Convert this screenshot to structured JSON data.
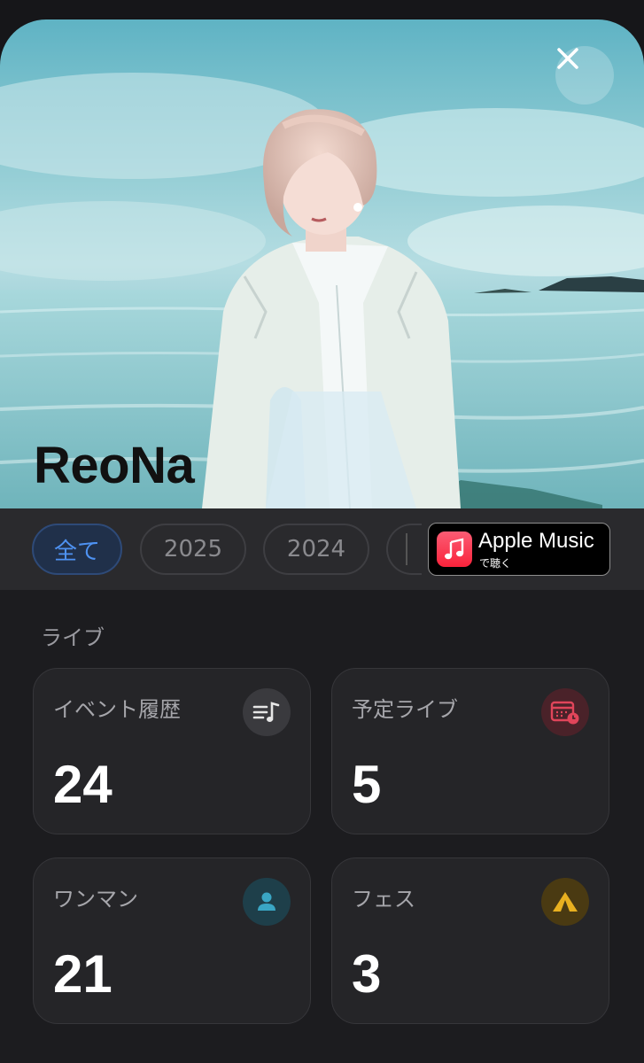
{
  "artist": {
    "name": "ReoNa"
  },
  "filters": {
    "chips": [
      {
        "label": "全て",
        "active": true
      },
      {
        "label": "2025",
        "active": false
      },
      {
        "label": "2024",
        "active": false
      }
    ]
  },
  "apple_music": {
    "title": "Apple Music",
    "subtitle": "で聴く"
  },
  "section": {
    "title": "ライブ"
  },
  "stats": [
    {
      "label": "イベント履歴",
      "value": "24",
      "icon": "playlist-music-icon",
      "icon_color": "#e6e6e6"
    },
    {
      "label": "予定ライブ",
      "value": "5",
      "icon": "calendar-clock-icon",
      "icon_color": "#e0455a"
    },
    {
      "label": "ワンマン",
      "value": "21",
      "icon": "person-icon",
      "icon_color": "#3aa6c4"
    },
    {
      "label": "フェス",
      "value": "3",
      "icon": "tent-icon",
      "icon_color": "#e8b020"
    }
  ],
  "colors": {
    "accent": "#4e92f2",
    "background": "#1c1c1f",
    "card": "#252528"
  }
}
